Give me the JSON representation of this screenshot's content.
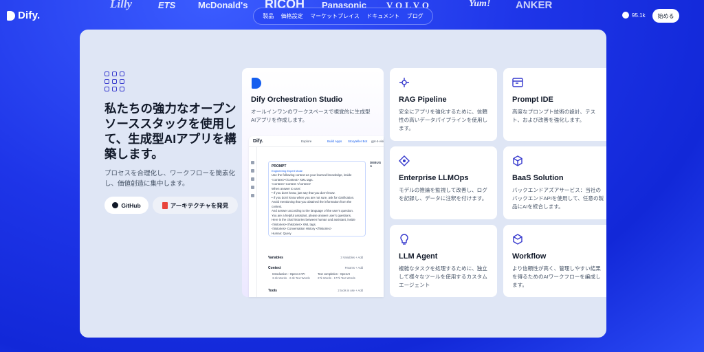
{
  "header": {
    "logo_text": "Dify.",
    "brands": [
      "Lilly",
      "ETS",
      "McDonald's",
      "RICOH",
      "Panasonic",
      "VOLVO",
      "Yum!",
      "ANKER"
    ],
    "nav": [
      "製品",
      "価格設定",
      "マーケットプレイス",
      "ドキュメント",
      "ブログ"
    ],
    "github_stars": "95.1k",
    "start_label": "始める"
  },
  "hero": {
    "title": "私たちの強力なオープンソーススタックを使用して、生成型AIアプリを構築します。",
    "subtitle": "プロセスを合理化し、ワークフローを簡素化し、価値創造に集中します。",
    "github_label": "GitHub",
    "architecture_label": "アーキテクチャを発見"
  },
  "orchestration": {
    "title": "Dify Orchestration Studio",
    "desc": "オールインワンのワークスペースで視覚的に生成型AIアプリを作成します。",
    "mock": {
      "logo": "Dify.",
      "tabs": [
        "Explore",
        "Build Apps",
        "Storyteller Bot",
        "gpt-4-visio"
      ],
      "prompt_head": "PROMPT",
      "prompt_sub": "Engineering Expert Mode",
      "prompt_lines": [
        "Use the following context as your learned knowledge, inside <context></context> XML tags.",
        "<context> Context </context>",
        "When answer to user:",
        "• If you don't know, just say that you don't know.",
        "• If you don't know when you are not sure, ask for clarification.",
        "Avoid mentioning that you obtained the information from the context.",
        "And answer according to the language of the user's question.",
        "You are a helpful assistant, please answer user's questions.",
        "Here is the chat histories between human and assistant, inside <histories></histories> XML tags.",
        "<histories> Conversation History </histories>",
        "Human: Query",
        "750"
      ],
      "debug_label": "DEBUG A",
      "variables_label": "Variables",
      "variables_right": "3 Variables  + Add",
      "context_label": "Context",
      "context_right": "Params  + Add",
      "context_items": [
        "Introduction - OpenAI API",
        "Text completion - OpenAI"
      ],
      "context_meta": [
        "3.2k Words · 2.3k Text Words",
        "27k Words · 177k Text Words"
      ],
      "tools_label": "Tools",
      "tools_right": "2 tools in use  + Add"
    }
  },
  "features": [
    {
      "icon": "rag-pipeline-icon",
      "title": "RAG Pipeline",
      "desc": "安全にアプリを強化するために、信頼性の高いデータパイプラインを使用します。"
    },
    {
      "icon": "prompt-ide-icon",
      "title": "Prompt IDE",
      "desc": "高度なプロンプト技術の設計、テスト、および改善を強化します。"
    },
    {
      "icon": "llmops-icon",
      "title": "Enterprise LLMOps",
      "desc": "モデルの推論を監視して改善し、ログを記録し、データに注釈を付けます。"
    },
    {
      "icon": "baas-icon",
      "title": "BaaS Solution",
      "desc": "バックエンドアズアサービス：当社のバックエンドAPIを使用して、任意の製品にAIを統合します。"
    },
    {
      "icon": "llm-agent-icon",
      "title": "LLM Agent",
      "desc": "複雑なタスクを処理するために、独立して様々なツールを使用するカスタムエージェント"
    },
    {
      "icon": "workflow-icon",
      "title": "Workflow",
      "desc": "より信頼性が高く、管理しやすい結果を得るためのAIワークフローを編成します。"
    }
  ],
  "colors": {
    "background": "#1e35e8",
    "accent": "#155eef",
    "panel": "#dfe6f5"
  }
}
